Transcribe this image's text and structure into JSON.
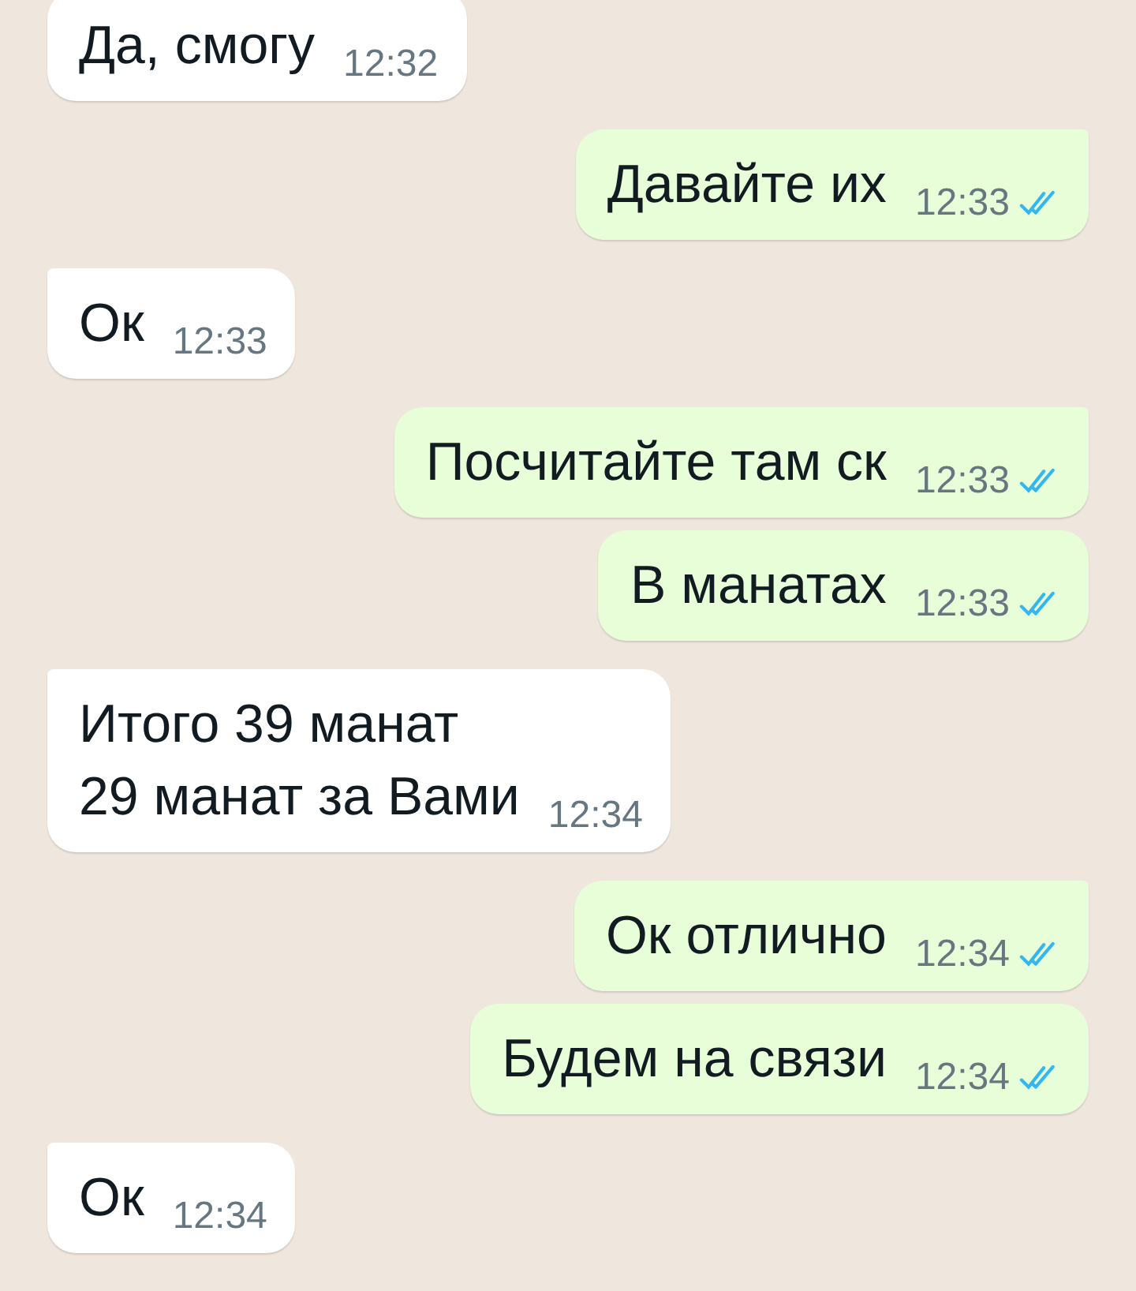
{
  "messages": [
    {
      "kind": "incoming",
      "tail": false,
      "text": "Да, смогу",
      "time": "12:32"
    },
    {
      "kind": "outgoing",
      "tail": true,
      "text": "Давайте их",
      "time": "12:33",
      "read": true
    },
    {
      "kind": "incoming",
      "tail": true,
      "text": "Ок",
      "time": "12:33"
    },
    {
      "kind": "outgoing",
      "tail": true,
      "text": "Посчитайте там ск",
      "time": "12:33",
      "read": true
    },
    {
      "kind": "outgoing",
      "tail": false,
      "text": "В манатах",
      "time": "12:33",
      "read": true
    },
    {
      "kind": "incoming",
      "tail": true,
      "text": "Итого 39 манат\n29 манат за Вами",
      "time": "12:34"
    },
    {
      "kind": "outgoing",
      "tail": true,
      "text": "Ок отлично",
      "time": "12:34",
      "read": true
    },
    {
      "kind": "outgoing",
      "tail": false,
      "text": "Будем на связи",
      "time": "12:34",
      "read": true
    },
    {
      "kind": "incoming",
      "tail": true,
      "text": "Ок",
      "time": "12:34"
    }
  ]
}
